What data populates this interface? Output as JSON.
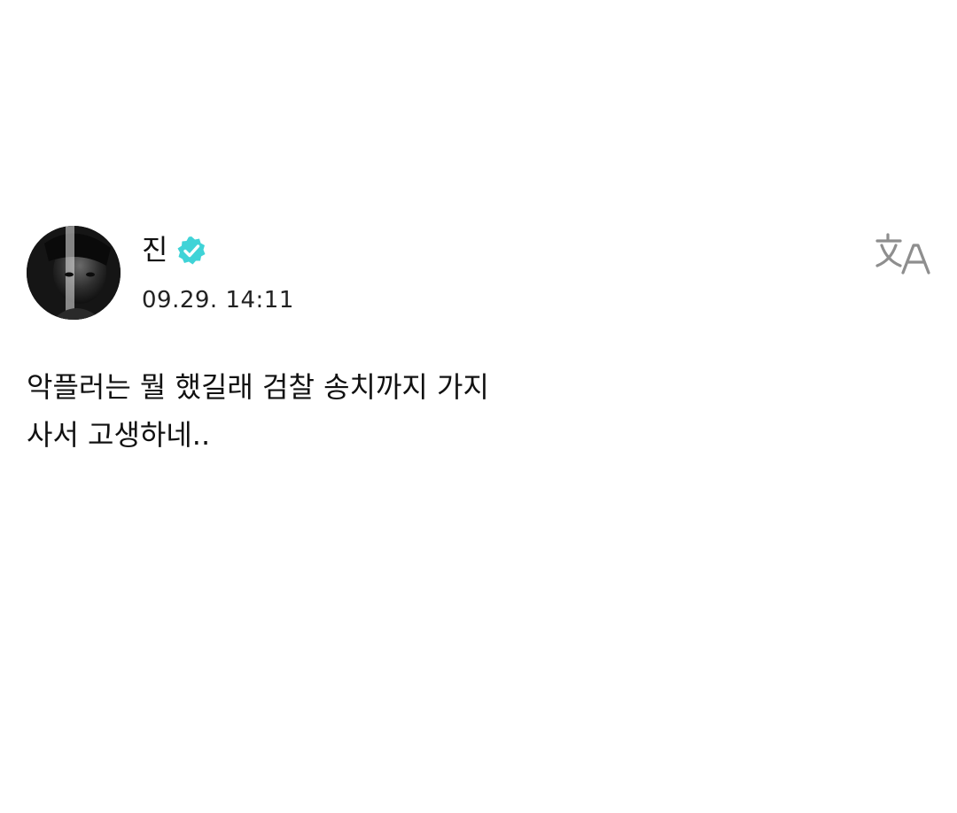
{
  "post": {
    "author": {
      "name": "진",
      "avatar_icon": "profile-photo",
      "verified": true,
      "verified_icon": "verified-check-badge-icon",
      "verified_color": "#3fd3d7"
    },
    "timestamp": "09.29. 14:11",
    "translate_icon": "translate-icon",
    "body_lines": [
      "악플러는 뭘 했길래 검찰 송치까지 가지",
      "사서 고생하네.."
    ]
  }
}
